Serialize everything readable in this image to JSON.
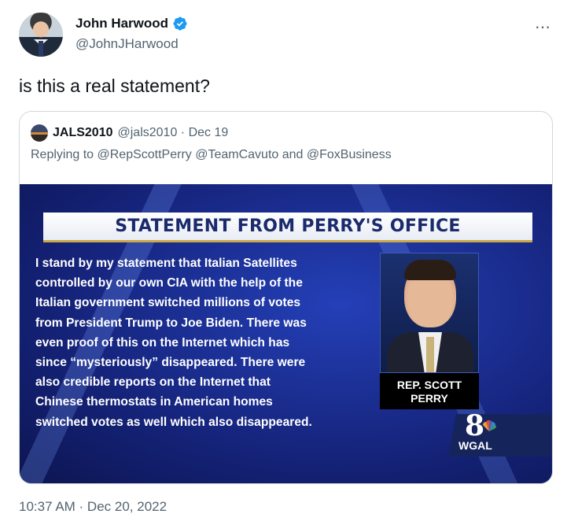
{
  "author": {
    "display_name": "John Harwood",
    "handle": "@JohnJHarwood",
    "verified_icon": "verified-badge-icon",
    "verified_color": "#1d9bf0"
  },
  "more_icon": "⋯",
  "tweet": {
    "text": "is this a real statement?",
    "timestamp": "10:37 AM · Dec 20, 2022"
  },
  "quoted": {
    "display_name": "JALS2010",
    "meta": "@jals2010 · Dec 19",
    "replying_to": "Replying to @RepScottPerry @TeamCavuto and @FoxBusiness",
    "media": {
      "banner": "STATEMENT FROM PERRY'S OFFICE",
      "statement_lines": [
        "I stand by my statement that Italian Satellites",
        "controlled by our own CIA with the help of the",
        "Italian government switched millions of votes",
        "from President Trump to Joe Biden.  There was",
        "even proof of this on the Internet which has",
        "since “mysteriously” disappeared.  There were",
        "also credible reports on the Internet that",
        "Chinese thermostats in American homes",
        "switched votes as well which also disappeared."
      ],
      "caption_line1": "REP. SCOTT",
      "caption_line2": "PERRY",
      "logo_number": "8",
      "logo_text": "WGAL"
    }
  }
}
